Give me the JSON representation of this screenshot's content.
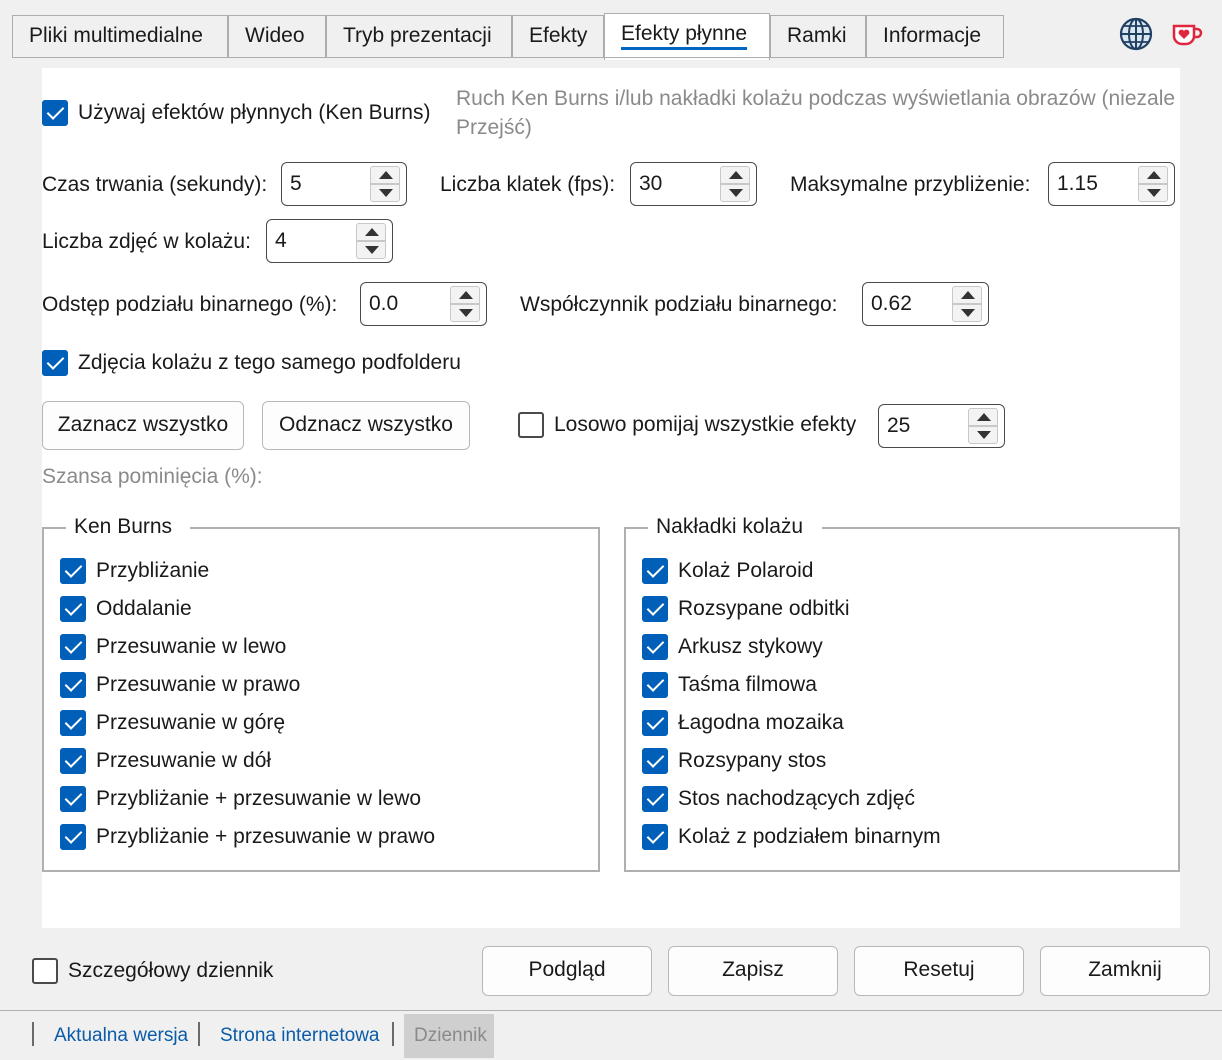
{
  "tabs": [
    {
      "label": "Pliki multimedialne"
    },
    {
      "label": "Wideo"
    },
    {
      "label": "Tryb prezentacji"
    },
    {
      "label": "Efekty"
    },
    {
      "label": "Efekty płynne"
    },
    {
      "label": "Ramki"
    },
    {
      "label": "Informacje"
    }
  ],
  "active_tab": "Efekty płynne",
  "header_icons": [
    "globe-icon",
    "coffee-heart-icon"
  ],
  "main": {
    "use_smooth": {
      "label": "Używaj efektów płynnych (Ken Burns)",
      "checked": true
    },
    "description_line1": "Ruch Ken Burns i/lub nakładki kolażu podczas wyświetlania obrazów (niezale",
    "description_line2": "Przejść)",
    "duration": {
      "label": "Czas trwania (sekundy):",
      "value": "5"
    },
    "fps": {
      "label": "Liczba klatek (fps):",
      "value": "30"
    },
    "max_zoom": {
      "label": "Maksymalne przybliżenie:",
      "value": "1.15"
    },
    "collage_count": {
      "label": "Liczba zdjęć w kolażu:",
      "value": "4"
    },
    "binary_gap": {
      "label": "Odstęp podziału binarnego (%):",
      "value": "0.0"
    },
    "binary_ratio": {
      "label": "Współczynnik podziału binarnego:",
      "value": "0.62"
    },
    "same_subfolder": {
      "label": "Zdjęcia kolażu z tego samego podfolderu",
      "checked": true
    },
    "select_all": "Zaznacz wszystko",
    "deselect_all": "Odznacz wszystko",
    "random_skip": {
      "label": "Losowo pomijaj wszystkie efekty",
      "checked": false,
      "value": "25"
    },
    "skip_chance_label": "Szansa pominięcia (%):"
  },
  "ken_burns": {
    "title": "Ken Burns",
    "items": [
      {
        "label": "Przybliżanie",
        "checked": true
      },
      {
        "label": "Oddalanie",
        "checked": true
      },
      {
        "label": "Przesuwanie w lewo",
        "checked": true
      },
      {
        "label": "Przesuwanie w prawo",
        "checked": true
      },
      {
        "label": "Przesuwanie w górę",
        "checked": true
      },
      {
        "label": "Przesuwanie w dół",
        "checked": true
      },
      {
        "label": "Przybliżanie + przesuwanie w lewo",
        "checked": true
      },
      {
        "label": "Przybliżanie + przesuwanie w prawo",
        "checked": true
      }
    ]
  },
  "collage": {
    "title": "Nakładki kolażu",
    "items": [
      {
        "label": "Kolaż Polaroid",
        "checked": true
      },
      {
        "label": "Rozsypane odbitki",
        "checked": true
      },
      {
        "label": "Arkusz stykowy",
        "checked": true
      },
      {
        "label": "Taśma filmowa",
        "checked": true
      },
      {
        "label": "Łagodna mozaika",
        "checked": true
      },
      {
        "label": "Rozsypany stos",
        "checked": true
      },
      {
        "label": "Stos nachodzących zdjęć",
        "checked": true
      },
      {
        "label": "Kolaż z podziałem binarnym",
        "checked": true
      }
    ]
  },
  "footer": {
    "verbose_log": {
      "label": "Szczegółowy dziennik",
      "checked": false
    },
    "preview": "Podgląd",
    "save": "Zapisz",
    "reset": "Resetuj",
    "close": "Zamknij"
  },
  "status_bar": {
    "current_version": "Aktualna wersja",
    "website": "Strona internetowa",
    "log": "Dziennik"
  },
  "colors": {
    "accent": "#005fb8",
    "link": "#0a5ba8",
    "muted": "#8a8a8a"
  }
}
